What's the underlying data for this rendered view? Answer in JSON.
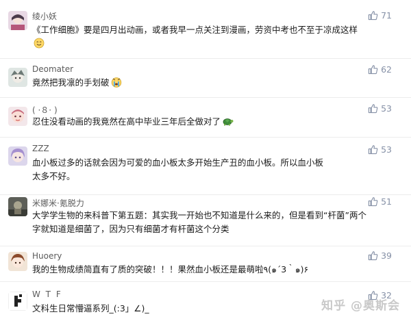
{
  "comments": [
    {
      "author": "绫小妖",
      "text": "《工作细胞》要是四月出动画，或者我早一点关注到漫画，劳资中考也不至于凉成这样",
      "likes": "71",
      "emoji": "smile-emoji"
    },
    {
      "author": "Deomater",
      "text": "竟然把我凛的手划破",
      "likes": "62",
      "emoji": "crying-face-emoji"
    },
    {
      "author": "( ·８· )",
      "text": "忍住没看动画的我竟然在高中毕业三年后全做对了",
      "likes": "53",
      "emoji": "turtle-emoji"
    },
    {
      "author": "ZZZ",
      "text": "血小板过多的话就会因为可爱的血小板太多开始生产丑的血小板。所以血小板太多不好。",
      "likes": "53"
    },
    {
      "author": "米娜米·氪脱力",
      "text": "大学学生物的来科普下第五题：其实我一开始也不知道是什么来的，但是看到“杆菌”两个字就知道是细菌了，因为只有细菌才有杆菌这个分类",
      "likes": "51"
    },
    {
      "author": "Huoery",
      "text": "我的生物成绩简直有了质的突破！！！果然血小板还是最萌啦٩(๑´3｀๑)۶",
      "likes": "39"
    },
    {
      "author": "W T F",
      "text": "文科生日常懵逼系列_(:3」∠)_",
      "likes": "32"
    }
  ],
  "watermark": "知乎 @奥斯会",
  "colors": {
    "text": "#1a1a1a",
    "meta": "#8590a6",
    "divider": "#ececec",
    "watermark": "#c9c9c9"
  }
}
